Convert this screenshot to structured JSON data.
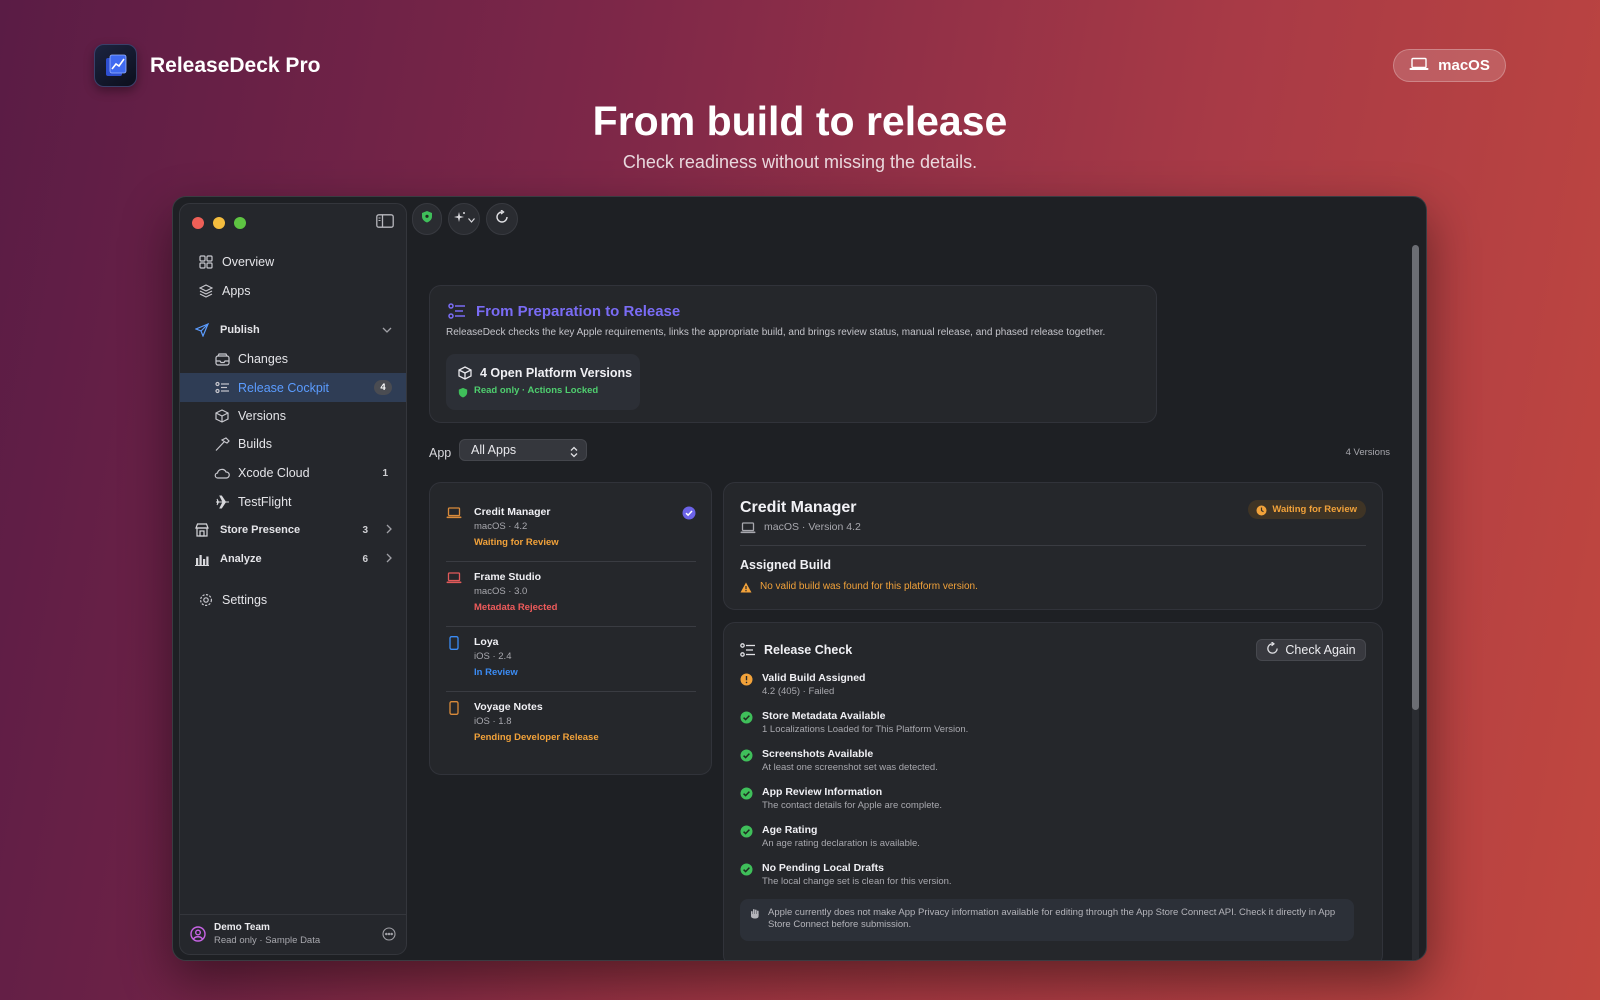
{
  "brand": {
    "name": "ReleaseDeck Pro"
  },
  "platform_pill": {
    "label": "macOS",
    "icon": "laptop-icon"
  },
  "hero": {
    "title": "From build to release",
    "subtitle": "Check readiness without missing the details."
  },
  "sidebar": {
    "items": [
      {
        "label": "Overview",
        "icon": "grid-icon"
      },
      {
        "label": "Apps",
        "icon": "layers-icon"
      },
      {
        "label": "Publish",
        "icon": "paper-plane-icon"
      },
      {
        "label": "Changes",
        "icon": "tray-icon"
      },
      {
        "label": "Release Cockpit",
        "icon": "checklist-icon",
        "badge": "4"
      },
      {
        "label": "Versions",
        "icon": "box-icon"
      },
      {
        "label": "Builds",
        "icon": "hammer-icon"
      },
      {
        "label": "Xcode Cloud",
        "icon": "cloud-icon",
        "count": "1"
      },
      {
        "label": "TestFlight",
        "icon": "airplane-icon"
      },
      {
        "label": "Store Presence",
        "icon": "storefront-icon",
        "count": "3"
      },
      {
        "label": "Analyze",
        "icon": "bar-chart-icon",
        "count": "6"
      },
      {
        "label": "Settings",
        "icon": "gear-icon"
      }
    ],
    "footer": {
      "team": "Demo Team",
      "sub": "Read only · Sample Data"
    }
  },
  "intro": {
    "title": "From Preparation to Release",
    "description": "ReleaseDeck checks the key Apple requirements, links the appropriate build, and brings review status, manual release, and phased release together.",
    "open_versions": "4 Open Platform Versions",
    "open_versions_sub": "Read only · Actions Locked"
  },
  "filter": {
    "label": "App",
    "selected": "All Apps",
    "versions_count": "4 Versions"
  },
  "apps": [
    {
      "name": "Credit Manager",
      "meta": "macOS · 4.2",
      "status": "Waiting for Review",
      "status_color": "#f2a23a",
      "icon_color": "#d98a3a",
      "selected": true
    },
    {
      "name": "Frame Studio",
      "meta": "macOS · 3.0",
      "status": "Metadata Rejected",
      "status_color": "#ef5b5b",
      "icon_color": "#e25a5a",
      "selected": false
    },
    {
      "name": "Loya",
      "meta": "iOS · 2.4",
      "status": "In Review",
      "status_color": "#3b8cf5",
      "icon_color": "#3b8cf5",
      "selected": false
    },
    {
      "name": "Voyage Notes",
      "meta": "iOS · 1.8",
      "status": "Pending Developer Release",
      "status_color": "#f2a23a",
      "icon_color": "#d98a3a",
      "selected": false
    }
  ],
  "detail": {
    "name": "Credit Manager",
    "meta": "macOS · Version 4.2",
    "status": "Waiting for Review",
    "assigned_build_title": "Assigned Build",
    "assigned_build_warning": "No valid build was found for this platform version."
  },
  "release_check": {
    "title": "Release Check",
    "button": "Check Again",
    "items": [
      {
        "title": "Valid Build Assigned",
        "desc": "4.2 (405) · Failed",
        "state": "warning"
      },
      {
        "title": "Store Metadata Available",
        "desc": "1 Localizations Loaded for This Platform Version.",
        "state": "ok"
      },
      {
        "title": "Screenshots Available",
        "desc": "At least one screenshot set was detected.",
        "state": "ok"
      },
      {
        "title": "App Review Information",
        "desc": "The contact details for Apple are complete.",
        "state": "ok"
      },
      {
        "title": "Age Rating",
        "desc": "An age rating declaration is available.",
        "state": "ok"
      },
      {
        "title": "No Pending Local Drafts",
        "desc": "The local change set is clean for this version.",
        "state": "ok"
      }
    ],
    "note": "Apple currently does not make App Privacy information available for editing through the App Store Connect API. Check it directly in App Store Connect before submission."
  },
  "colors": {
    "accent": "#5b9cff",
    "purple": "#7a6cf5",
    "success": "#4fcf6f",
    "warning": "#f2a23a",
    "danger": "#ef5b5b"
  }
}
